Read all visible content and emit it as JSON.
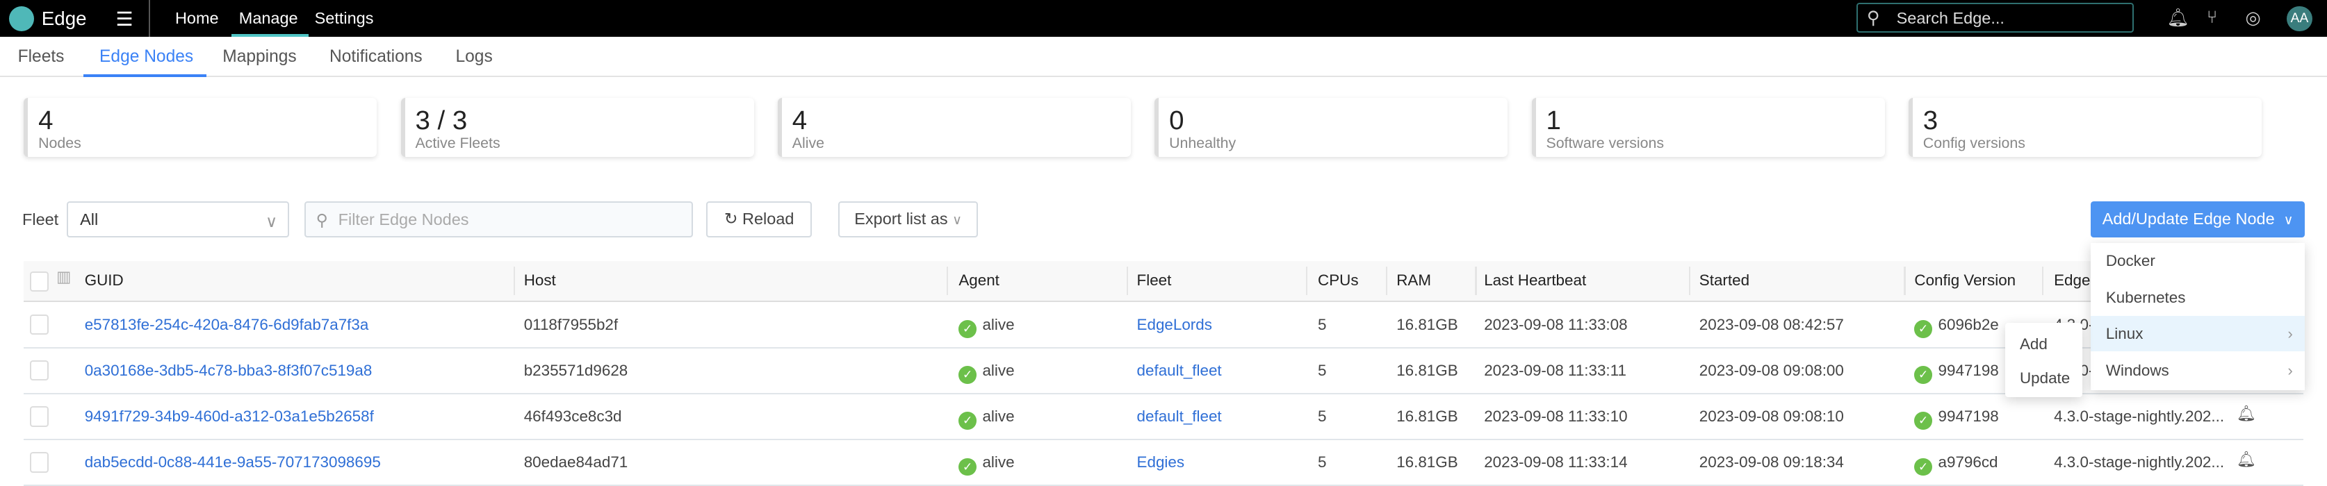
{
  "topbar": {
    "brand": "Edge",
    "nav": [
      {
        "label": "Home"
      },
      {
        "label": "Manage",
        "active": true
      },
      {
        "label": "Settings"
      }
    ],
    "search_placeholder": "Search Edge...",
    "avatar": "AA",
    "accent": "#4fc4c4"
  },
  "tabs": [
    {
      "label": "Fleets"
    },
    {
      "label": "Edge Nodes",
      "active": true
    },
    {
      "label": "Mappings"
    },
    {
      "label": "Notifications"
    },
    {
      "label": "Logs"
    }
  ],
  "stats": [
    {
      "value": "4",
      "label": "Nodes"
    },
    {
      "value": "3 / 3",
      "label": "Active Fleets"
    },
    {
      "value": "4",
      "label": "Alive"
    },
    {
      "value": "0",
      "label": "Unhealthy"
    },
    {
      "value": "1",
      "label": "Software versions"
    },
    {
      "value": "3",
      "label": "Config versions"
    }
  ],
  "toolbar": {
    "fleet_label": "Fleet",
    "fleet_value": "All",
    "filter_placeholder": "Filter Edge Nodes",
    "reload": "Reload",
    "export": "Export list as",
    "add_update": "Add/Update Edge Node"
  },
  "table": {
    "columns": [
      "GUID",
      "Host",
      "Agent",
      "Fleet",
      "CPUs",
      "RAM",
      "Last Heartbeat",
      "Started",
      "Config Version",
      "Edge"
    ],
    "rows": [
      {
        "guid": "e57813fe-254c-420a-8476-6d9fab7a7f3a",
        "host": "0118f7955b2f",
        "agent": "alive",
        "fleet": "EdgeLords",
        "cpus": "5",
        "ram": "16.81GB",
        "heartbeat": "2023-09-08 11:33:08",
        "started": "2023-09-08 08:42:57",
        "config": "6096b2e",
        "edge": "4.3.0-stage-nightly.202..."
      },
      {
        "guid": "0a30168e-3db5-4c78-bba3-8f3f07c519a8",
        "host": "b235571d9628",
        "agent": "alive",
        "fleet": "default_fleet",
        "cpus": "5",
        "ram": "16.81GB",
        "heartbeat": "2023-09-08 11:33:11",
        "started": "2023-09-08 09:08:00",
        "config": "9947198",
        "edge": "4.3.0-stage-nightly.202..."
      },
      {
        "guid": "9491f729-34b9-460d-a312-03a1e5b2658f",
        "host": "46f493ce8c3d",
        "agent": "alive",
        "fleet": "default_fleet",
        "cpus": "5",
        "ram": "16.81GB",
        "heartbeat": "2023-09-08 11:33:10",
        "started": "2023-09-08 09:08:10",
        "config": "9947198",
        "edge": "4.3.0-stage-nightly.202..."
      },
      {
        "guid": "dab5ecdd-0c88-441e-9a55-707173098695",
        "host": "80edae84ad71",
        "agent": "alive",
        "fleet": "Edgies",
        "cpus": "5",
        "ram": "16.81GB",
        "heartbeat": "2023-09-08 11:33:14",
        "started": "2023-09-08 09:18:34",
        "config": "a9796cd",
        "edge": "4.3.0-stage-nightly.202..."
      }
    ]
  },
  "menu": {
    "items": [
      {
        "label": "Docker"
      },
      {
        "label": "Kubernetes"
      },
      {
        "label": "Linux",
        "highlighted": true,
        "submenu": true
      },
      {
        "label": "Windows",
        "submenu": true
      }
    ],
    "submenu": [
      "Add",
      "Update"
    ]
  }
}
